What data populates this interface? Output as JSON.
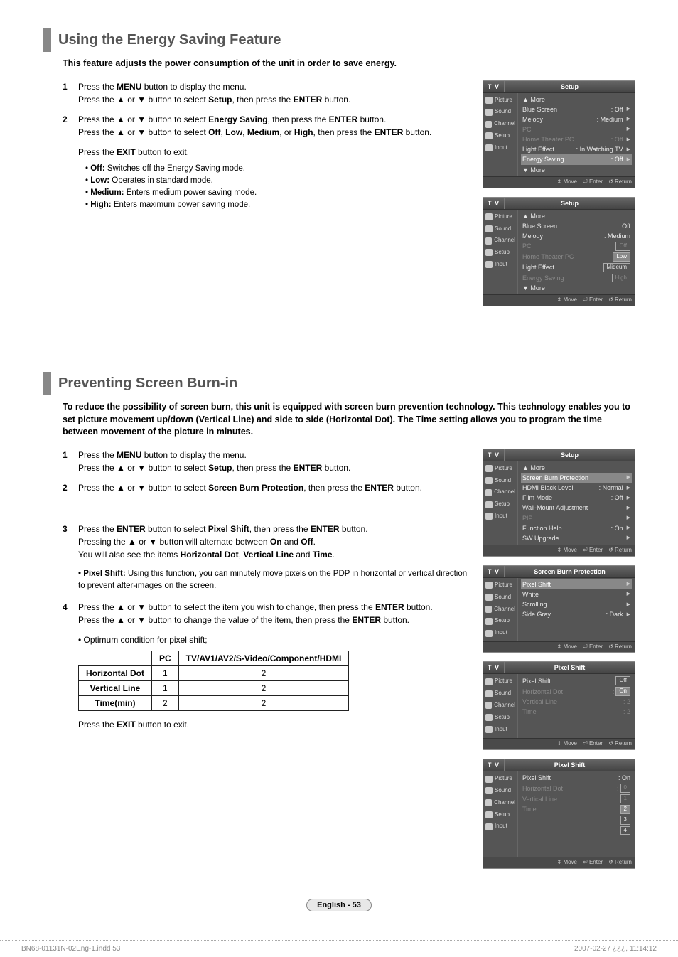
{
  "section1": {
    "title": "Using the Energy Saving Feature",
    "desc": "This feature adjusts the power consumption of the unit in order to save energy.",
    "steps": [
      {
        "num": "1",
        "html": "Press the <b>MENU</b> button to display the menu.<br>Press the ▲ or ▼ button to select <b>Setup</b>, then press the <b>ENTER</b> button."
      },
      {
        "num": "2",
        "html": "Press the ▲ or ▼ button to select <b>Energy Saving</b>, then press the <b>ENTER</b> button.<br>Press the ▲ or ▼ button to select <b>Off</b>, <b>Low</b>, <b>Medium</b>, or <b>High</b>, then press the <b>ENTER</b> button."
      }
    ],
    "exit_note": "Press the <b>EXIT</b> button to exit.",
    "bullets": [
      "<b>Off:</b> Switches off the Energy Saving mode.",
      "<b>Low:</b> Operates in standard mode.",
      "<b>Medium:</b> Enters medium power saving mode.",
      "<b>High:</b> Enters maximum power saving mode."
    ]
  },
  "section2": {
    "title": "Preventing Screen Burn-in",
    "desc": "To reduce the possibility of screen burn, this unit is equipped with screen burn prevention technology. This technology enables you to set picture movement up/down (Vertical Line) and side to side (Horizontal Dot). The Time setting allows you to program the time between movement of the picture in minutes.",
    "steps": [
      {
        "num": "1",
        "html": "Press the <b>MENU</b> button to display the menu.<br>Press the ▲ or ▼ button to select <b>Setup</b>, then press the <b>ENTER</b> button."
      },
      {
        "num": "2",
        "html": "Press the ▲ or ▼ button to select <b>Screen Burn Protection</b>, then press the <b>ENTER</b> button."
      },
      {
        "num": "3",
        "html": "Press the <b>ENTER</b> button to select <b>Pixel Shift</b>, then press the <b>ENTER</b> button.<br>Pressing the ▲ or ▼ button will alternate between <b>On</b> and <b>Off</b>.<br>You will also see the items <b>Horizontal Dot</b>, <b>Vertical Line</b> and <b>Time</b>."
      },
      {
        "num": "4",
        "html": "Press the ▲ or ▼ button to select the item you wish to change, then press the <b>ENTER</b> button.<br>Press the ▲ or ▼ button to change the value of the item, then press the <b>ENTER</b> button."
      }
    ],
    "note3": "<b>Pixel Shift:</b> Using this function, you can minutely move pixels on the PDP in horizontal or vertical direction to prevent after-images on the screen.",
    "opt_note": "• Optimum condition for pixel shift;",
    "table": {
      "head": [
        "",
        "PC",
        "TV/AV1/AV2/S-Video/Component/HDMI"
      ],
      "rows": [
        [
          "Horizontal Dot",
          "1",
          "2"
        ],
        [
          "Vertical Line",
          "1",
          "2"
        ],
        [
          "Time(min)",
          "2",
          "2"
        ]
      ]
    },
    "exit_note": "Press the <b>EXIT</b> button to exit."
  },
  "osd_side": [
    {
      "label": "Picture"
    },
    {
      "label": "Sound"
    },
    {
      "label": "Channel"
    },
    {
      "label": "Setup"
    },
    {
      "label": "Input"
    }
  ],
  "osd_footer": {
    "move": "Move",
    "enter": "Enter",
    "return": "Return"
  },
  "osd1": {
    "title": "Setup",
    "rows": [
      {
        "label": "▲ More",
        "val": "",
        "cls": ""
      },
      {
        "label": "Blue Screen",
        "val": ": Off",
        "arrow": true
      },
      {
        "label": "Melody",
        "val": ": Medium",
        "arrow": true
      },
      {
        "label": "PC",
        "val": "",
        "cls": "dim",
        "arrow": true
      },
      {
        "label": "Home Theater PC",
        "val": ": Off",
        "cls": "dim",
        "arrow": true
      },
      {
        "label": "Light Effect",
        "val": ": In Watching TV",
        "arrow": true
      },
      {
        "label": "Energy Saving",
        "val": ": Off",
        "cls": "hi",
        "arrow": true
      },
      {
        "label": "▼ More",
        "val": ""
      }
    ]
  },
  "osd2": {
    "title": "Setup",
    "rows": [
      {
        "label": "▲ More",
        "val": ""
      },
      {
        "label": "Blue Screen",
        "val": ": Off"
      },
      {
        "label": "Melody",
        "val": ": Medium"
      },
      {
        "label": "PC",
        "val": "",
        "cls": "dim",
        "box": "Off"
      },
      {
        "label": "Home Theater PC",
        "val": "",
        "cls": "dim",
        "box": "Low",
        "boxhi": true
      },
      {
        "label": "Light Effect",
        "val": "",
        "box": "Mideum"
      },
      {
        "label": "Energy Saving",
        "val": "",
        "cls": "dim",
        "box": "High"
      },
      {
        "label": "▼ More",
        "val": ""
      }
    ]
  },
  "osd3": {
    "title": "Setup",
    "rows": [
      {
        "label": "▲ More",
        "val": ""
      },
      {
        "label": "Screen Burn Protection",
        "val": "",
        "hi": true,
        "arrow": true
      },
      {
        "label": "HDMI Black Level",
        "val": ": Normal",
        "arrow": true
      },
      {
        "label": "Film Mode",
        "val": ": Off",
        "arrow": true
      },
      {
        "label": "Wall-Mount Adjustment",
        "val": "",
        "arrow": true
      },
      {
        "label": "PIP",
        "val": "",
        "cls": "dim",
        "arrow": true
      },
      {
        "label": "Function Help",
        "val": ": On",
        "arrow": true
      },
      {
        "label": "SW Upgrade",
        "val": "",
        "arrow": true
      }
    ]
  },
  "osd4": {
    "title": "Screen Burn Protection",
    "rows": [
      {
        "label": "Pixel Shift",
        "val": "",
        "hi": true,
        "arrow": true
      },
      {
        "label": "White",
        "val": "",
        "arrow": true
      },
      {
        "label": "Scrolling",
        "val": "",
        "arrow": true
      },
      {
        "label": "Side Gray",
        "val": ": Dark",
        "arrow": true
      }
    ],
    "spacer": true
  },
  "osd5": {
    "title": "Pixel Shift",
    "rows": [
      {
        "label": "Pixel Shift",
        "val": "",
        "box": "Off"
      },
      {
        "label": "Horizontal Dot",
        "val": ":",
        "cls": "dim",
        "box": "On",
        "boxhi": true
      },
      {
        "label": "Vertical Line",
        "val": ": 2",
        "cls": "dim"
      },
      {
        "label": "Time",
        "val": ": 2",
        "cls": "dim"
      }
    ],
    "spacer": true
  },
  "osd6": {
    "title": "Pixel Shift",
    "rows": [
      {
        "label": "Pixel Shift",
        "val": ": On"
      },
      {
        "label": "Horizontal Dot",
        "val": ":",
        "cls": "dim",
        "box": "0"
      },
      {
        "label": "Vertical Line",
        "val": ":",
        "cls": "dim",
        "box": "1"
      },
      {
        "label": "Time",
        "val": ":",
        "cls": "dim",
        "box": "2",
        "boxhi": true
      },
      {
        "label": "",
        "val": "",
        "box": "3"
      },
      {
        "label": "",
        "val": "",
        "box": "4"
      }
    ],
    "spacer": true
  },
  "footer": {
    "page_label": "English - 53",
    "doc_left": "BN68-01131N-02Eng-1.indd   53",
    "doc_right": "2007-02-27   ¿¿¿, 11:14:12"
  }
}
